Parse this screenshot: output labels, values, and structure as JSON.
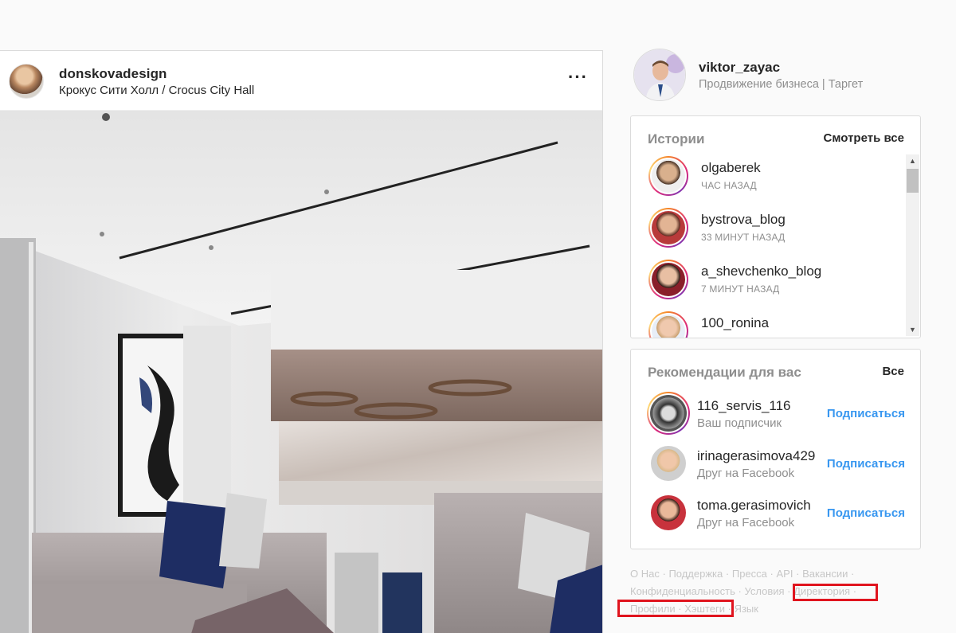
{
  "post": {
    "username": "donskovadesign",
    "location": "Крокус Сити Холл / Crocus City Hall",
    "more_label": "···"
  },
  "profile": {
    "username": "viktor_zayac",
    "bio": "Продвижение бизнеса | Таргет"
  },
  "stories": {
    "title": "Истории",
    "see_all": "Смотреть все",
    "items": [
      {
        "name": "olgaberek",
        "time": "ЧАС НАЗАД"
      },
      {
        "name": "bystrova_blog",
        "time": "33 МИНУТ НАЗАД"
      },
      {
        "name": "a_shevchenko_blog",
        "time": "7 МИНУТ НАЗАД"
      },
      {
        "name": "100_ronina",
        "time": ""
      }
    ]
  },
  "suggestions": {
    "title": "Рекомендации для вас",
    "all": "Все",
    "items": [
      {
        "name": "116_servis_116",
        "subtitle": "Ваш подписчик",
        "action": "Подписаться"
      },
      {
        "name": "irinagerasimova429",
        "subtitle": "Друг на Facebook",
        "action": "Подписаться"
      },
      {
        "name": "toma.gerasimovich",
        "subtitle": "Друг на Facebook",
        "action": "Подписаться"
      }
    ]
  },
  "footer": {
    "links": [
      "О Нас",
      "Поддержка",
      "Пресса",
      "API",
      "Вакансии",
      "Конфиденциальность",
      "Условия",
      "Директория",
      "Профили",
      "Хэштеги",
      "Язык"
    ],
    "separator": "·"
  },
  "colors": {
    "link_blue": "#3897f0",
    "muted": "#8e8e8e",
    "annotation_red": "#e0141e"
  }
}
